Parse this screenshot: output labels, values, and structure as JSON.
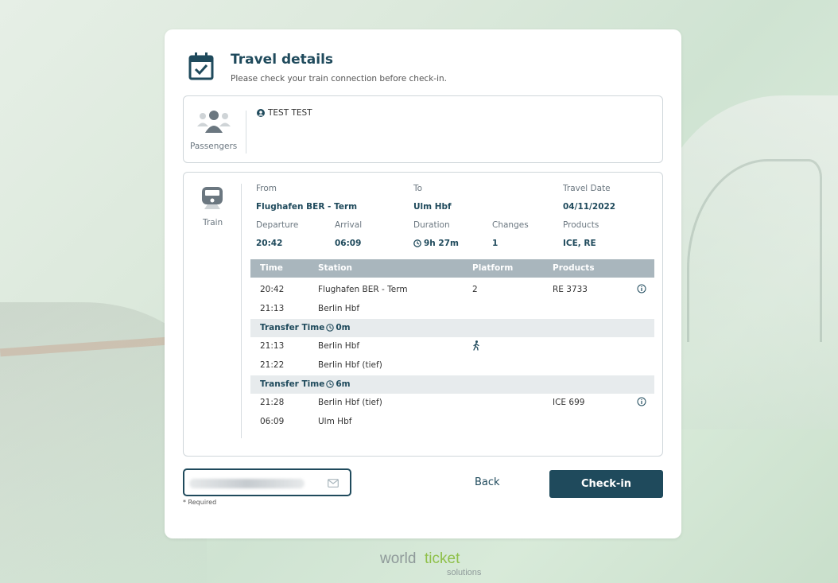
{
  "header": {
    "title": "Travel details",
    "subtitle": "Please check your train connection before check-in."
  },
  "passengers": {
    "label": "Passengers",
    "items": [
      "TEST TEST"
    ]
  },
  "journey": {
    "mode_label": "Train",
    "from_label": "From",
    "from_value": "Flughafen BER - Term",
    "to_label": "To",
    "to_value": "Ulm Hbf",
    "date_label": "Travel Date",
    "date_value": "04/11/2022",
    "departure_label": "Departure",
    "departure_value": "20:42",
    "arrival_label": "Arrival",
    "arrival_value": "06:09",
    "duration_label": "Duration",
    "duration_value": "9h 27m",
    "changes_label": "Changes",
    "changes_value": "1",
    "products_label": "Products",
    "products_value": "ICE, RE"
  },
  "table": {
    "headers": {
      "time": "Time",
      "station": "Station",
      "platform": "Platform",
      "products": "Products"
    },
    "seg1": {
      "r1": {
        "time": "20:42",
        "station": "Flughafen BER - Term",
        "platform": "2",
        "product": "RE 3733"
      },
      "r2": {
        "time": "21:13",
        "station": "Berlin Hbf"
      }
    },
    "transfer1": {
      "label": "Transfer Time",
      "value": "0m"
    },
    "walk": {
      "r1": {
        "time": "21:13",
        "station": "Berlin Hbf"
      },
      "r2": {
        "time": "21:22",
        "station": "Berlin Hbf (tief)"
      }
    },
    "transfer2": {
      "label": "Transfer Time",
      "value": "6m"
    },
    "seg2": {
      "r1": {
        "time": "21:28",
        "station": "Berlin Hbf (tief)",
        "product": "ICE 699"
      },
      "r2": {
        "time": "06:09",
        "station": "Ulm Hbf"
      }
    }
  },
  "form": {
    "email_value": "",
    "required_note": "* Required",
    "back_label": "Back",
    "checkin_label": "Check-in"
  },
  "branding": {
    "logo_part1": "world",
    "logo_part2": "ticket",
    "logo_part3": "solutions"
  },
  "colors": {
    "accent": "#1f4a5c",
    "table_header": "#a9b6bd",
    "transfer_row": "#e7ebed",
    "logo_green": "#8fc04a"
  },
  "icons": [
    "calendar-check-icon",
    "passengers-icon",
    "user-circle-icon",
    "train-icon",
    "clock-icon",
    "walking-icon",
    "info-icon",
    "envelope-icon"
  ]
}
